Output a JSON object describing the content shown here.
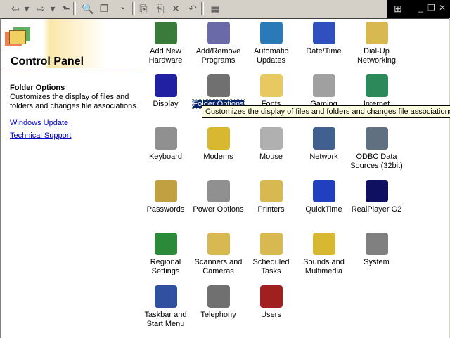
{
  "toolbar": {
    "buttons": [
      "back",
      "forward",
      "up",
      "search",
      "folders",
      "history",
      "move-to",
      "copy-to",
      "delete",
      "undo",
      "views"
    ],
    "glyphs": [
      "⇦",
      "▾",
      "⇨",
      "▾",
      "⬑",
      "🔍",
      "❐",
      "◔",
      "⎘",
      "⎗",
      "✕",
      "↶",
      "▦"
    ]
  },
  "window": {
    "minimize": "_",
    "restore": "❐",
    "close": "✕"
  },
  "left_panel": {
    "title": "Control Panel",
    "selected_title": "Folder Options",
    "selected_desc": "Customizes the display of files and folders and changes file associations.",
    "links": [
      "Windows Update",
      "Technical Support"
    ]
  },
  "tooltip": "Customizes the display of files and folders and changes file associations.",
  "items": [
    {
      "label": "Add New Hardware",
      "color": "#3a7a3a"
    },
    {
      "label": "Add/Remove Programs",
      "color": "#6a6aa8"
    },
    {
      "label": "Automatic Updates",
      "color": "#2a7ab8"
    },
    {
      "label": "Date/Time",
      "color": "#3050c0"
    },
    {
      "label": "Dial-Up Networking",
      "color": "#d8b850"
    },
    {
      "label": "Display",
      "color": "#2020a0"
    },
    {
      "label": "Folder Options",
      "color": "#707070"
    },
    {
      "label": "Fonts",
      "color": "#e8c860"
    },
    {
      "label": "Gaming",
      "color": "#a0a0a0"
    },
    {
      "label": "Internet",
      "color": "#2a8a5a"
    },
    {
      "label": "Keyboard",
      "color": "#909090"
    },
    {
      "label": "Modems",
      "color": "#d8b830"
    },
    {
      "label": "Mouse",
      "color": "#b0b0b0"
    },
    {
      "label": "Network",
      "color": "#406090"
    },
    {
      "label": "ODBC Data Sources (32bit)",
      "color": "#607080"
    },
    {
      "label": "Passwords",
      "color": "#c0a040"
    },
    {
      "label": "Power Options",
      "color": "#909090"
    },
    {
      "label": "Printers",
      "color": "#d8b850"
    },
    {
      "label": "QuickTime",
      "color": "#2040c0"
    },
    {
      "label": "RealPlayer G2",
      "color": "#101060"
    },
    {
      "label": "Regional Settings",
      "color": "#2a8a3a"
    },
    {
      "label": "Scanners and Cameras",
      "color": "#d8b850"
    },
    {
      "label": "Scheduled Tasks",
      "color": "#d8b850"
    },
    {
      "label": "Sounds and Multimedia",
      "color": "#d8b830"
    },
    {
      "label": "System",
      "color": "#808080"
    },
    {
      "label": "Taskbar and Start Menu",
      "color": "#3050a0"
    },
    {
      "label": "Telephony",
      "color": "#707070"
    },
    {
      "label": "Users",
      "color": "#a02020"
    }
  ]
}
